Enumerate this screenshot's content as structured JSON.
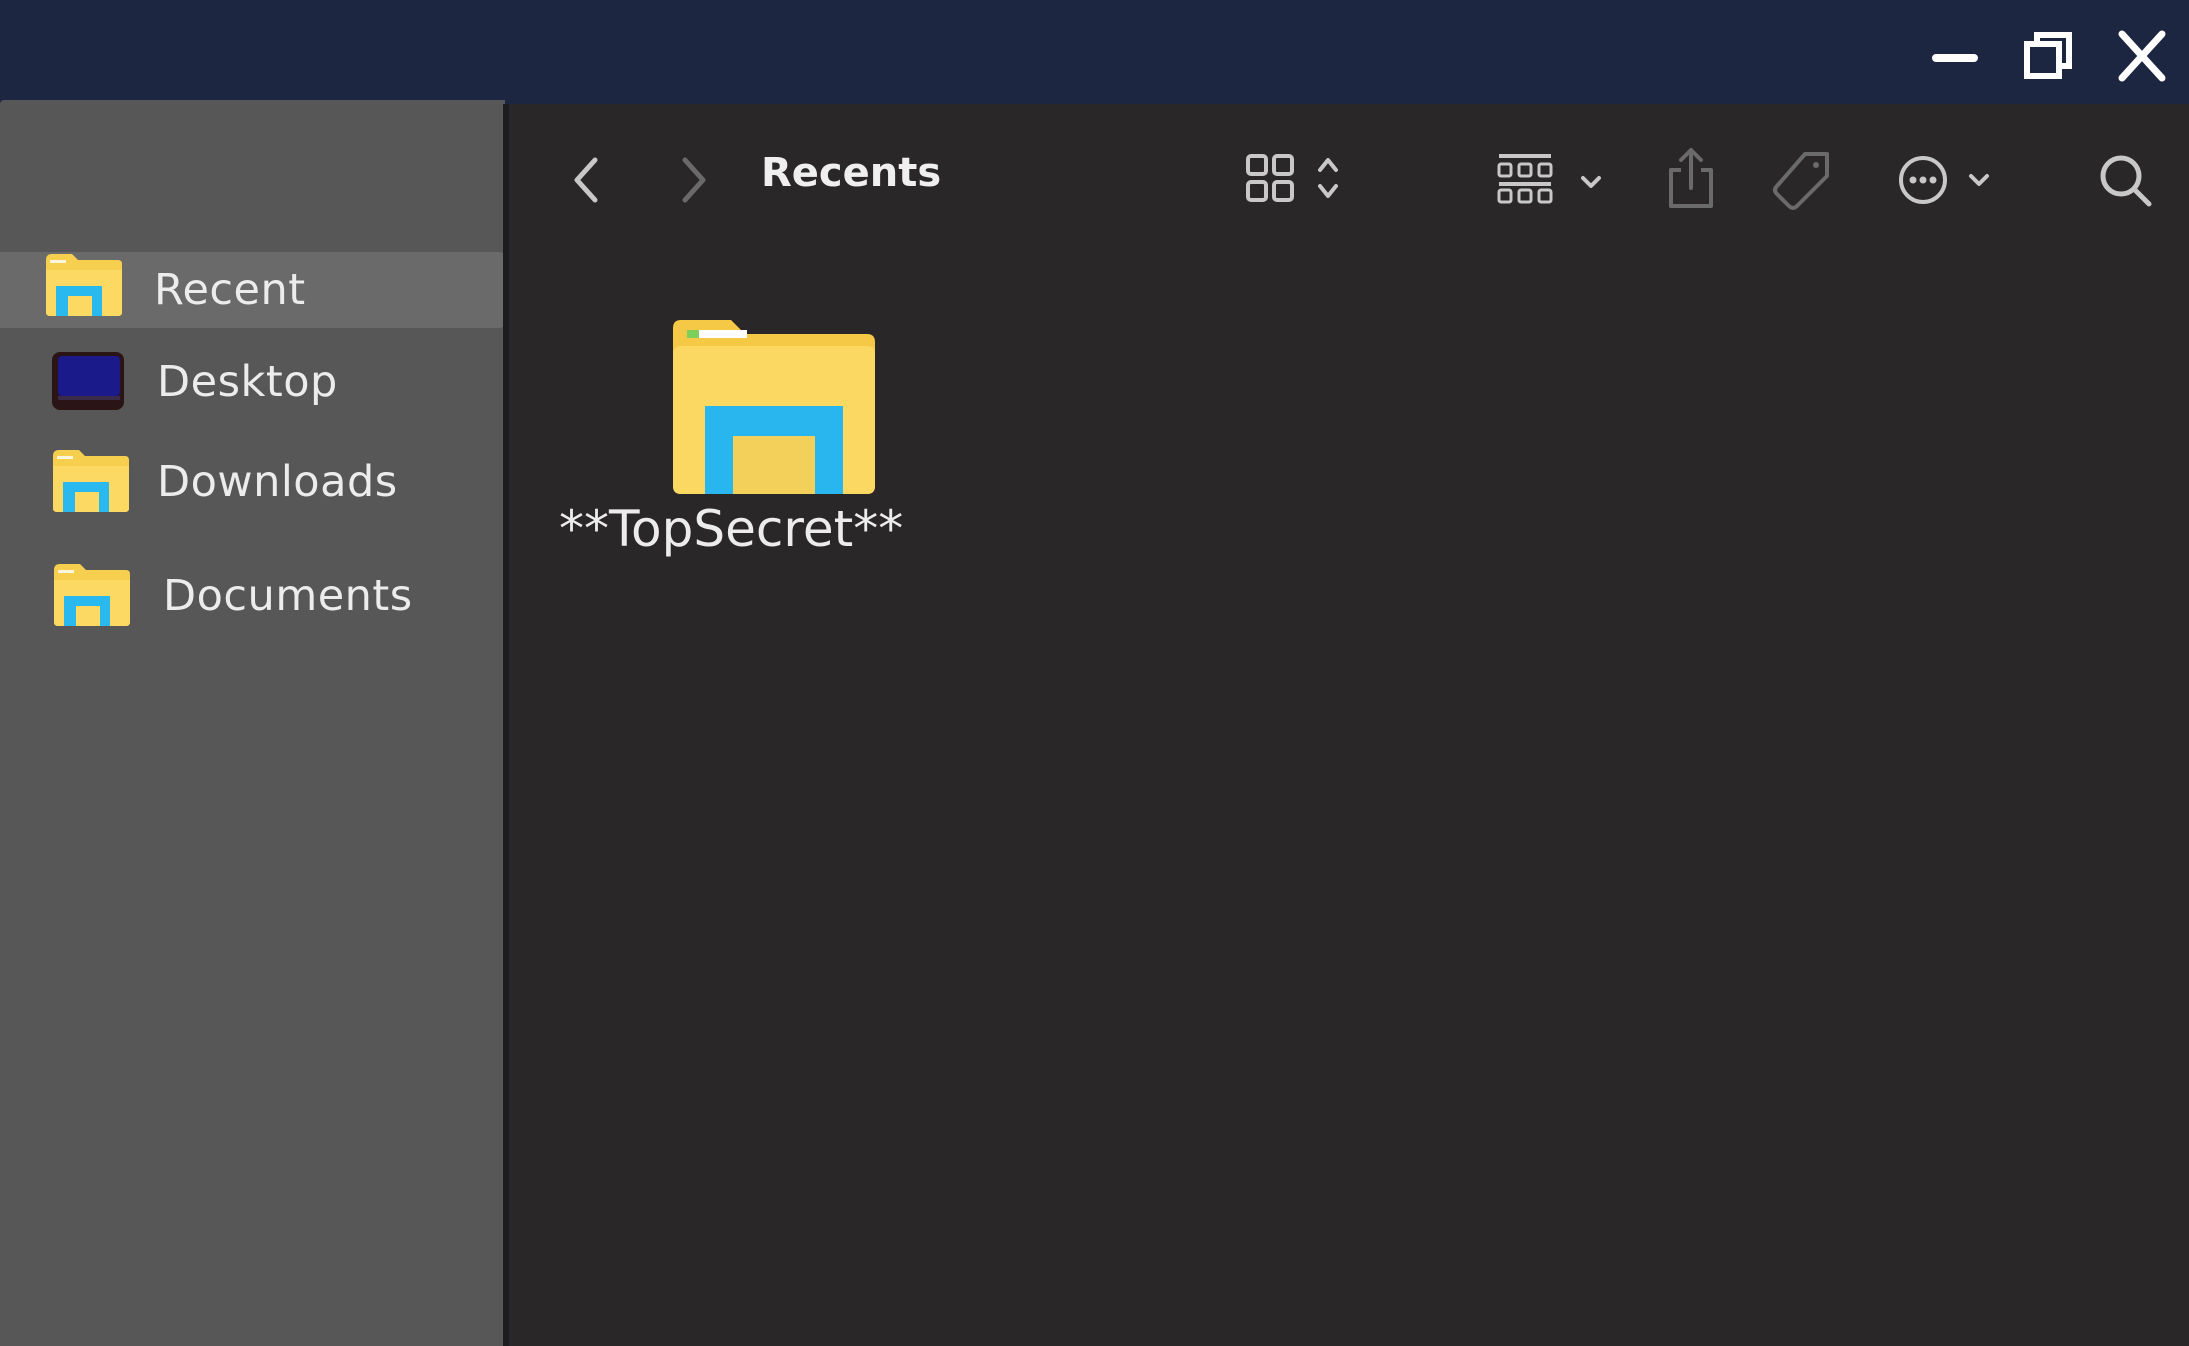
{
  "window": {
    "title_bar_color": "#1d2640",
    "buttons": {
      "minimize_icon": "minimize-icon",
      "restore_icon": "restore-icon",
      "close_icon": "close-icon"
    }
  },
  "sidebar": {
    "background": "#575757",
    "items": [
      {
        "label": "Recent",
        "icon": "explorer-folder-icon",
        "selected": true
      },
      {
        "label": "Desktop",
        "icon": "desktop-icon",
        "selected": false
      },
      {
        "label": "Downloads",
        "icon": "explorer-folder-icon",
        "selected": false
      },
      {
        "label": "Documents",
        "icon": "explorer-folder-icon",
        "selected": false
      }
    ]
  },
  "toolbar": {
    "title": "Recents",
    "icons": [
      "back-icon",
      "forward-icon",
      "grid-view-icon",
      "sort-icon",
      "group-icon",
      "chevron-down-icon",
      "share-icon",
      "tag-icon",
      "more-icon",
      "chevron-down-icon",
      "search-icon"
    ]
  },
  "main": {
    "background": "#2a2729",
    "files": [
      {
        "name": "**TopSecret**",
        "icon": "explorer-folder-icon"
      }
    ]
  }
}
